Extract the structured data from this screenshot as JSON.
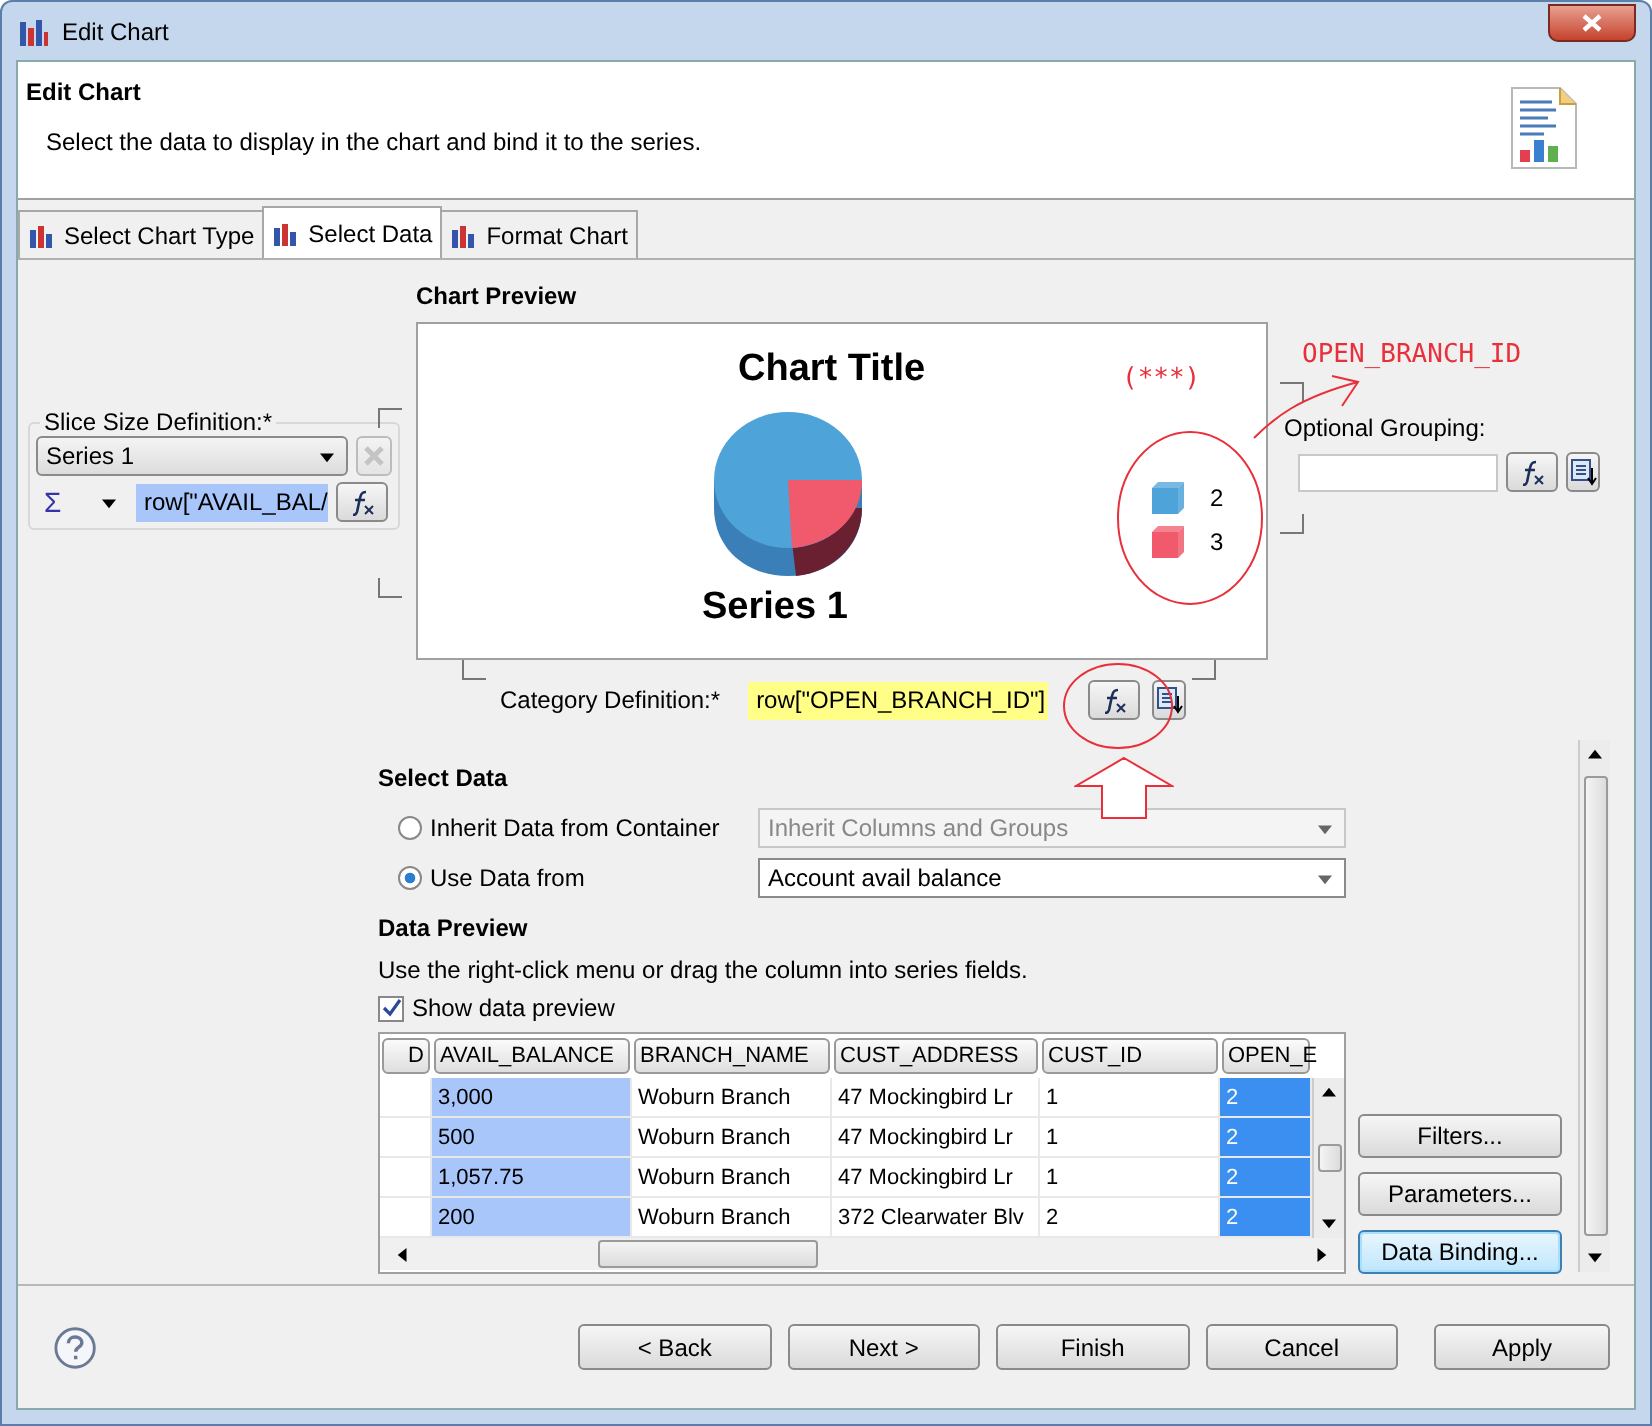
{
  "window": {
    "title": "Edit Chart"
  },
  "header": {
    "title": "Edit Chart",
    "description": "Select the data to display in the chart and bind it to the series."
  },
  "tabs": [
    {
      "label": "Select Chart Type",
      "selected": false
    },
    {
      "label": "Select Data",
      "selected": true
    },
    {
      "label": "Format Chart",
      "selected": false
    }
  ],
  "slice_size": {
    "legend": "Slice Size Definition:*",
    "series": "Series 1",
    "aggregate": "Σ",
    "expression": "row[\"AVAIL_BAL/"
  },
  "chart_preview": {
    "label": "Chart Preview",
    "title": "Chart Title",
    "series_label": "Series 1",
    "legend": [
      {
        "label": "2",
        "color": "#4ea3d8"
      },
      {
        "label": "3",
        "color": "#f05a6c"
      }
    ]
  },
  "category": {
    "label": "Category Definition:*",
    "expression": "row[\"OPEN_BRANCH_ID\"]"
  },
  "optional_grouping": {
    "label": "Optional Grouping:"
  },
  "annotations": {
    "note": "(***)",
    "callout": "OPEN_BRANCH_ID"
  },
  "select_data": {
    "title": "Select Data",
    "options": [
      {
        "label": "Inherit Data from Container",
        "selected": false,
        "combo": "Inherit Columns and Groups"
      },
      {
        "label": "Use Data from",
        "selected": true,
        "combo": "Account avail balance"
      }
    ]
  },
  "data_preview": {
    "title": "Data Preview",
    "hint": "Use the right-click menu or drag the column into series fields.",
    "show_preview": {
      "label": "Show data preview",
      "checked": true
    },
    "columns": [
      {
        "label": "D",
        "highlighted": false,
        "selected": false
      },
      {
        "label": "AVAIL_BALANCE",
        "highlighted": true,
        "selected": false
      },
      {
        "label": "BRANCH_NAME",
        "highlighted": false,
        "selected": false
      },
      {
        "label": "CUST_ADDRESS",
        "highlighted": false,
        "selected": false
      },
      {
        "label": "CUST_ID",
        "highlighted": false,
        "selected": false
      },
      {
        "label": "OPEN_E",
        "highlighted": true,
        "selected": true
      }
    ],
    "rows": [
      [
        null,
        "3,000",
        "Woburn Branch",
        "47 Mockingbird Lr",
        "1",
        "2"
      ],
      [
        null,
        "500",
        "Woburn Branch",
        "47 Mockingbird Lr",
        "1",
        "2"
      ],
      [
        null,
        "1,057.75",
        "Woburn Branch",
        "47 Mockingbird Lr",
        "1",
        "2"
      ],
      [
        null,
        "200",
        "Woburn Branch",
        "372 Clearwater Blv",
        "2",
        "2"
      ]
    ],
    "side_buttons": [
      {
        "label": "Filters...",
        "focused": false
      },
      {
        "label": "Parameters...",
        "focused": false
      },
      {
        "label": "Data Binding...",
        "focused": true
      }
    ]
  },
  "footer": {
    "buttons": [
      "< Back",
      "Next >",
      "Finish",
      "Cancel",
      "Apply"
    ]
  }
}
